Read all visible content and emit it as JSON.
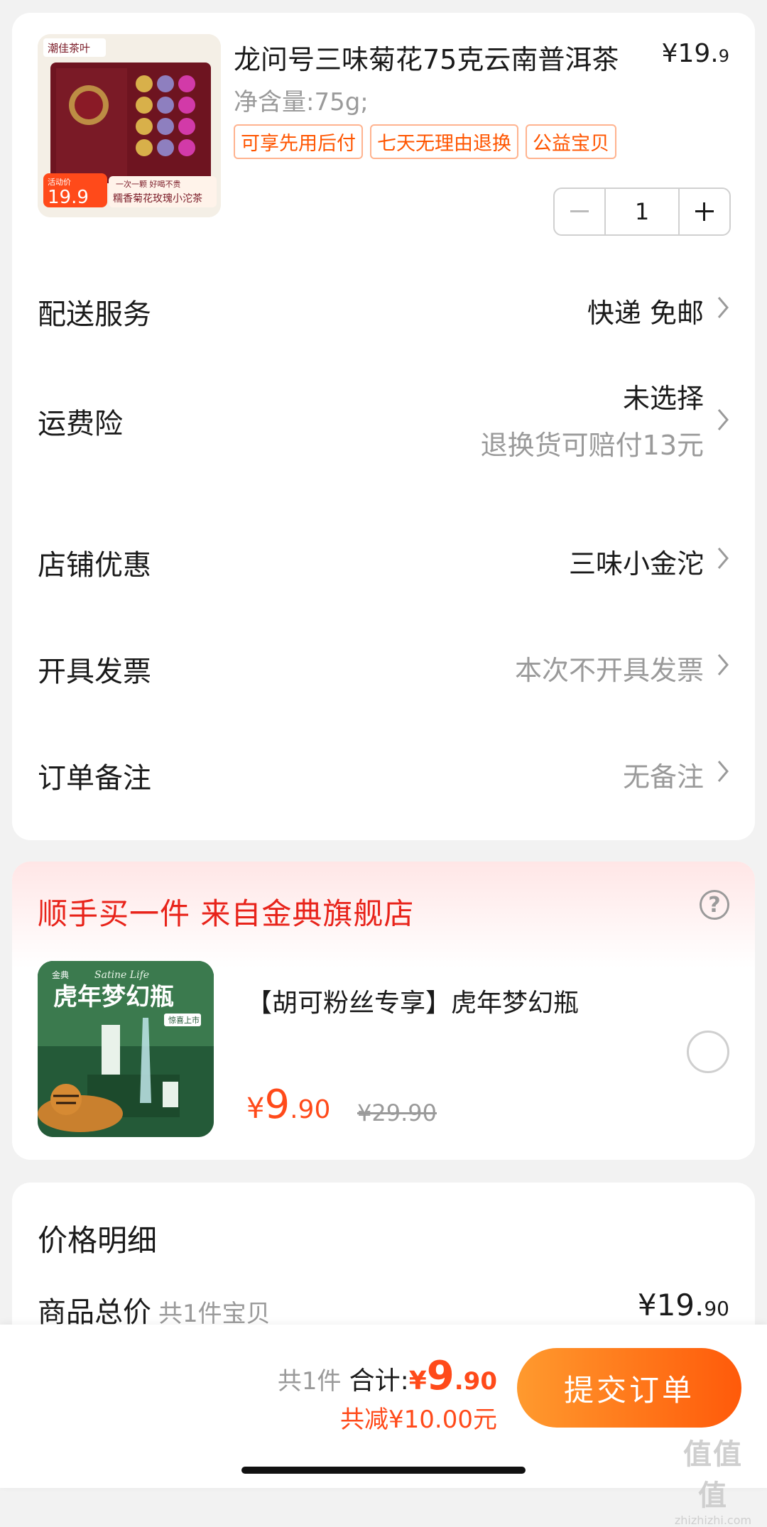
{
  "product": {
    "title": "龙问号三味菊花75克云南普洱茶",
    "price_main": "¥19.",
    "price_dec": "9",
    "spec": "净含量:75g;",
    "tags": [
      "可享先用后付",
      "七天无理由退换",
      "公益宝贝"
    ],
    "quantity": "1",
    "image": {
      "brand": "潮佳茶叶",
      "activity_label": "活动价",
      "activity_price": "19.9",
      "slogan": "一次一颗 好喝不贵",
      "name": "糯香菊花玫瑰小沱茶"
    }
  },
  "settings": [
    {
      "label": "配送服务",
      "value": "快递 免邮"
    },
    {
      "label": "运费险",
      "value": "未选择",
      "sub": "退换货可赔付13元"
    },
    {
      "label": "店铺优惠",
      "value": "三味小金沱"
    },
    {
      "label": "开具发票",
      "value": "本次不开具发票"
    },
    {
      "label": "订单备注",
      "value": "无备注"
    }
  ],
  "recommend": {
    "title": "顺手买一件  来自金典旗舰店",
    "help_icon": "?",
    "item_name": "【胡可粉丝专享】虎年梦幻瓶",
    "price_cur": "¥",
    "price_int": "9",
    "price_dec": ".90",
    "orig_price": "¥29.90",
    "image": {
      "brand": "金典",
      "script": "Satine Life",
      "headline": "虎年梦幻瓶",
      "badge": "惊喜上市"
    }
  },
  "price_detail": {
    "title": "价格明细",
    "row_label": "商品总价",
    "row_sub": "共1件宝贝",
    "row_value_main": "¥19.",
    "row_value_dec": "90"
  },
  "bottom_bar": {
    "count": "共1件",
    "total_label": "合计:",
    "total_cur": "¥",
    "total_int": "9",
    "total_dec": ".90",
    "saved": "共减¥10.00元",
    "submit_label": "提交订单"
  },
  "watermark": {
    "big": "值值值",
    "small": "zhizhizhi.com"
  },
  "colors": {
    "accent": "#ff4a1a",
    "red_title": "#e8231a",
    "tag_border": "#ffb38f"
  }
}
